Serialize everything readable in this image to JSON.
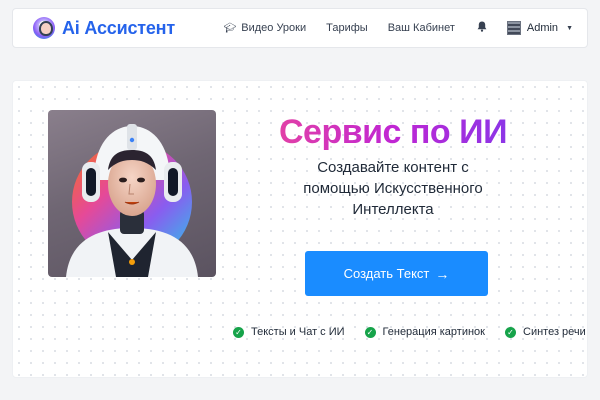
{
  "navbar": {
    "brand": "Ai Ассистент",
    "items": [
      {
        "label": "Видео Уроки",
        "icon": "graduation-cap-icon"
      },
      {
        "label": "Тарифы"
      },
      {
        "label": "Ваш Кабинет"
      }
    ],
    "notifications_icon": "bell-icon",
    "user": {
      "name": "Admin"
    }
  },
  "hero": {
    "title": "Сервис по ИИ",
    "subtitle": "Создавайте контент с помощью Искусственного Интеллекта",
    "cta_label": "Создать Текст",
    "features": [
      "Тексты и Чат с ИИ",
      "Генерация картинок",
      "Синтез речи"
    ]
  },
  "colors": {
    "brand": "#2563eb",
    "cta": "#1a8cff",
    "title_gradient_start": "#ec4899",
    "title_gradient_end": "#7c3aed",
    "check": "#16a34a"
  }
}
